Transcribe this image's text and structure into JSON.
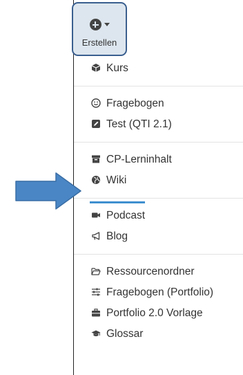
{
  "create_button": {
    "label": "Erstellen",
    "icon": "plus-circle-icon",
    "caret": "caret-down-icon"
  },
  "menu": {
    "groups": [
      [
        {
          "label": "Kurs",
          "icon": "cube-icon"
        }
      ],
      [
        {
          "label": "Fragebogen",
          "icon": "smiley-icon"
        },
        {
          "label": "Test (QTI 2.1)",
          "icon": "pencil-square-icon"
        }
      ],
      [
        {
          "label": "CP-Lerninhalt",
          "icon": "archive-icon"
        },
        {
          "label": "Wiki",
          "icon": "globe-icon"
        }
      ],
      [
        {
          "label": "Podcast",
          "icon": "video-camera-icon"
        },
        {
          "label": "Blog",
          "icon": "bullhorn-icon"
        }
      ],
      [
        {
          "label": "Ressourcenordner",
          "icon": "folder-open-icon"
        },
        {
          "label": "Fragebogen (Portfolio)",
          "icon": "sliders-icon"
        },
        {
          "label": "Portfolio 2.0 Vorlage",
          "icon": "briefcase-icon"
        },
        {
          "label": "Glossar",
          "icon": "graduation-cap-icon"
        }
      ]
    ]
  },
  "highlight": {
    "item": "Wiki",
    "arrow_color": "#4a86c5",
    "underline_color": "#3f8fcf"
  },
  "colors": {
    "button_bg": "#dde6ee",
    "button_border": "#3a5f8f",
    "text": "#333333"
  }
}
